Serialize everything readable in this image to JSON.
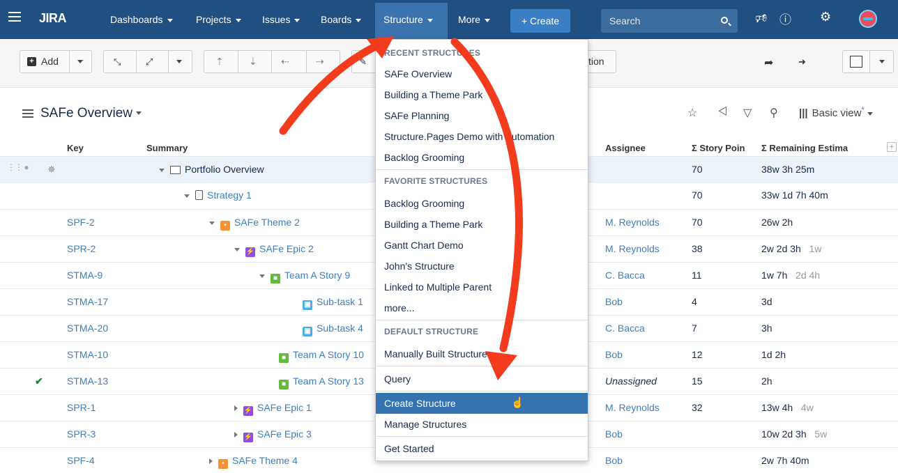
{
  "header": {
    "logo": "JIRA",
    "nav": {
      "dashboards": "Dashboards",
      "projects": "Projects",
      "issues": "Issues",
      "boards": "Boards",
      "structure": "Structure",
      "more": "More"
    },
    "create_label": "+ Create",
    "search_placeholder": "Search"
  },
  "toolbar": {
    "add_label": "Add",
    "partial_text": "tion"
  },
  "page": {
    "title": "SAFe Overview",
    "view_label": "Basic view",
    "view_modified": "*"
  },
  "columns": {
    "key": "Key",
    "summary": "Summary",
    "assignee": "Assignee",
    "story_points": "Σ Story Poin",
    "remaining": "Σ Remaining Estima"
  },
  "rows": [
    {
      "key": "",
      "summary": "Portfolio Overview",
      "assignee": "",
      "points": "70",
      "remaining": "38w 3h 25m",
      "remaining_extra": ""
    },
    {
      "key": "",
      "summary": "Strategy 1",
      "assignee": "",
      "points": "70",
      "remaining": "33w 1d 7h 40m",
      "remaining_extra": ""
    },
    {
      "key": "SPF-2",
      "summary": "SAFe Theme 2",
      "assignee": "M. Reynolds",
      "points": "70",
      "remaining": "26w 2h",
      "remaining_extra": ""
    },
    {
      "key": "SPR-2",
      "summary": "SAFe Epic 2",
      "assignee": "M. Reynolds",
      "points": "38",
      "remaining": "2w 2d 3h",
      "remaining_extra": "1w"
    },
    {
      "key": "STMA-9",
      "summary": "Team A Story 9",
      "assignee": "C. Bacca",
      "points": "11",
      "remaining": "1w 7h",
      "remaining_extra": "2d 4h"
    },
    {
      "key": "STMA-17",
      "summary": "Sub-task 1",
      "assignee": "Bob",
      "points": "4",
      "remaining": "3d",
      "remaining_extra": ""
    },
    {
      "key": "STMA-20",
      "summary": "Sub-task 4",
      "assignee": "C. Bacca",
      "points": "7",
      "remaining": "3h",
      "remaining_extra": ""
    },
    {
      "key": "STMA-10",
      "summary": "Team A Story 10",
      "assignee": "Bob",
      "points": "12",
      "remaining": "1d 2h",
      "remaining_extra": ""
    },
    {
      "key": "STMA-13",
      "summary": "Team A Story 13",
      "assignee": "Unassigned",
      "points": "15",
      "remaining": "2h",
      "remaining_extra": ""
    },
    {
      "key": "SPR-1",
      "summary": "SAFe Epic 1",
      "assignee": "M. Reynolds",
      "points": "32",
      "remaining": "13w 4h",
      "remaining_extra": "4w"
    },
    {
      "key": "SPR-3",
      "summary": "SAFe Epic 3",
      "assignee": "Bob",
      "points": "",
      "remaining": "10w 2d 3h",
      "remaining_extra": "5w"
    },
    {
      "key": "SPF-4",
      "summary": "SAFe Theme 4",
      "assignee": "Bob",
      "points": "",
      "remaining": "2w 7h 40m",
      "remaining_extra": ""
    }
  ],
  "dropdown": {
    "recent_header": "RECENT STRUCTURES",
    "recent": [
      "SAFe Overview",
      "Building a Theme Park",
      "SAFe Planning",
      "Structure.Pages Demo with Automation",
      "Backlog Grooming"
    ],
    "favorite_header": "FAVORITE STRUCTURES",
    "favorites": [
      "Backlog Grooming",
      "Building a Theme Park",
      "Gantt Chart Demo",
      "John's Structure",
      "Linked to Multiple Parent",
      "more..."
    ],
    "default_header": "DEFAULT STRUCTURE",
    "default_item": "Manually Built Structure",
    "query": "Query",
    "create": "Create Structure",
    "manage": "Manage Structures",
    "get_started": "Get Started"
  },
  "colors": {
    "header_bg": "#205081",
    "accent": "#3b7fc4",
    "annotation_arrow": "#f23c1d"
  }
}
